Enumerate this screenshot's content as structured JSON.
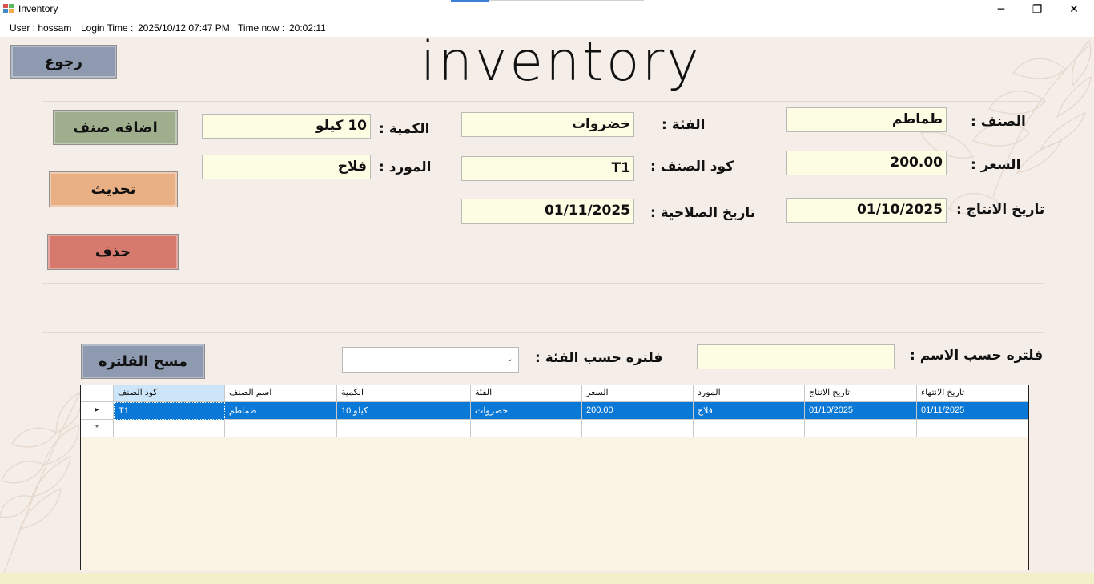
{
  "window": {
    "title": "Inventory",
    "minimize_glyph": "─",
    "maximize_glyph": "❐",
    "close_glyph": "✕"
  },
  "status": {
    "user": "User : hossam",
    "login_label": "Login Time :",
    "login_time": "2025/10/12 07:47 PM",
    "now_label": "Time now :",
    "now_time": "20:02:11"
  },
  "header": {
    "title": "inventory",
    "back_label": "رجوع"
  },
  "form": {
    "item_label": "الصنف :",
    "item_value": "طماطم",
    "category_label": "الفئة :",
    "category_value": "خضروات",
    "quantity_label": "الكمية :",
    "quantity_value": "10 كيلو",
    "price_label": "السعر :",
    "price_value": "200.00",
    "code_label": "كود الصنف :",
    "code_value": "T1",
    "supplier_label": "المورد :",
    "supplier_value": "فلاح",
    "prod_date_label": "تاريخ الانتاج :",
    "prod_date_value": "01/10/2025",
    "exp_date_label": "تاريخ الصلاحية :",
    "exp_date_value": "01/11/2025"
  },
  "actions": {
    "add_label": "اضافه صنف",
    "update_label": "تحديث",
    "delete_label": "حذف"
  },
  "filters": {
    "name_label": "فلتره حسب الاسم :",
    "name_value": "",
    "category_label": "فلتره حسب الفئة :",
    "category_value": "",
    "clear_label": "مسح الفلتره"
  },
  "grid": {
    "columns": [
      "كود الصنف",
      "اسم الصنف",
      "الكمية",
      "الفئة",
      "السعر",
      "المورد",
      "تاريخ الانتاج",
      "تاريخ الانتهاء"
    ],
    "rows": [
      [
        "T1",
        "طماطم",
        "10 كيلو",
        "خضروات",
        "200.00",
        "فلاح",
        "01/10/2025",
        "01/11/2025"
      ]
    ],
    "selected_row_marker": "▸",
    "new_row_marker": "*"
  },
  "colors": {
    "background": "#f5eee8",
    "field_bg": "#fdfde3",
    "back_button": "#8e9aaf",
    "add_button": "#9fae8c",
    "update_button": "#e9b086",
    "delete_button": "#d77a6e",
    "clear_button": "#8e9aaf",
    "selection": "#0a78d7"
  }
}
